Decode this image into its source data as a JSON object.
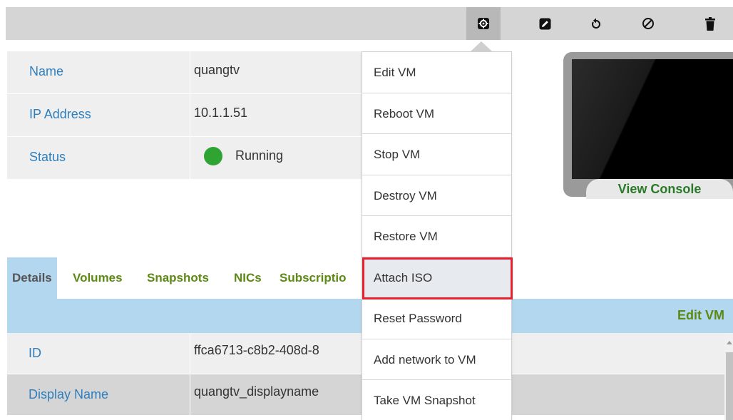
{
  "toolbar": {
    "buttons": [
      {
        "name": "settings",
        "icon": "gear-icon"
      },
      {
        "name": "edit",
        "icon": "pencil-icon"
      },
      {
        "name": "reset",
        "icon": "undo-icon"
      },
      {
        "name": "stop",
        "icon": "circle-slash-icon"
      },
      {
        "name": "delete",
        "icon": "trash-icon"
      }
    ]
  },
  "summary": {
    "rows": [
      {
        "label": "Name",
        "value": "quangtv"
      },
      {
        "label": "IP Address",
        "value": "10.1.1.51"
      },
      {
        "label": "Status",
        "value": "Running"
      }
    ],
    "status_color": "#2fa432"
  },
  "console": {
    "button_label": "View Console"
  },
  "tabs": {
    "items": [
      "Details",
      "Volumes",
      "Snapshots",
      "NICs",
      "Subscriptio"
    ],
    "active": "Details",
    "edit_label": "Edit VM"
  },
  "details": {
    "rows": [
      {
        "label": "ID",
        "value": "ffca6713-c8b2-408d-8"
      },
      {
        "label": "Display Name",
        "value": "quangtv_displayname"
      }
    ]
  },
  "menu": {
    "items": [
      "Edit VM",
      "Reboot VM",
      "Stop VM",
      "Destroy VM",
      "Restore VM",
      "Attach ISO",
      "Reset Password",
      "Add network to VM",
      "Take VM Snapshot"
    ],
    "highlighted": "Attach ISO",
    "highlight_color": "#e8212e"
  },
  "colors": {
    "label_blue": "#2e7fbf",
    "tab_green": "#5c8a13",
    "tabbar_blue": "#b3d7ee"
  }
}
